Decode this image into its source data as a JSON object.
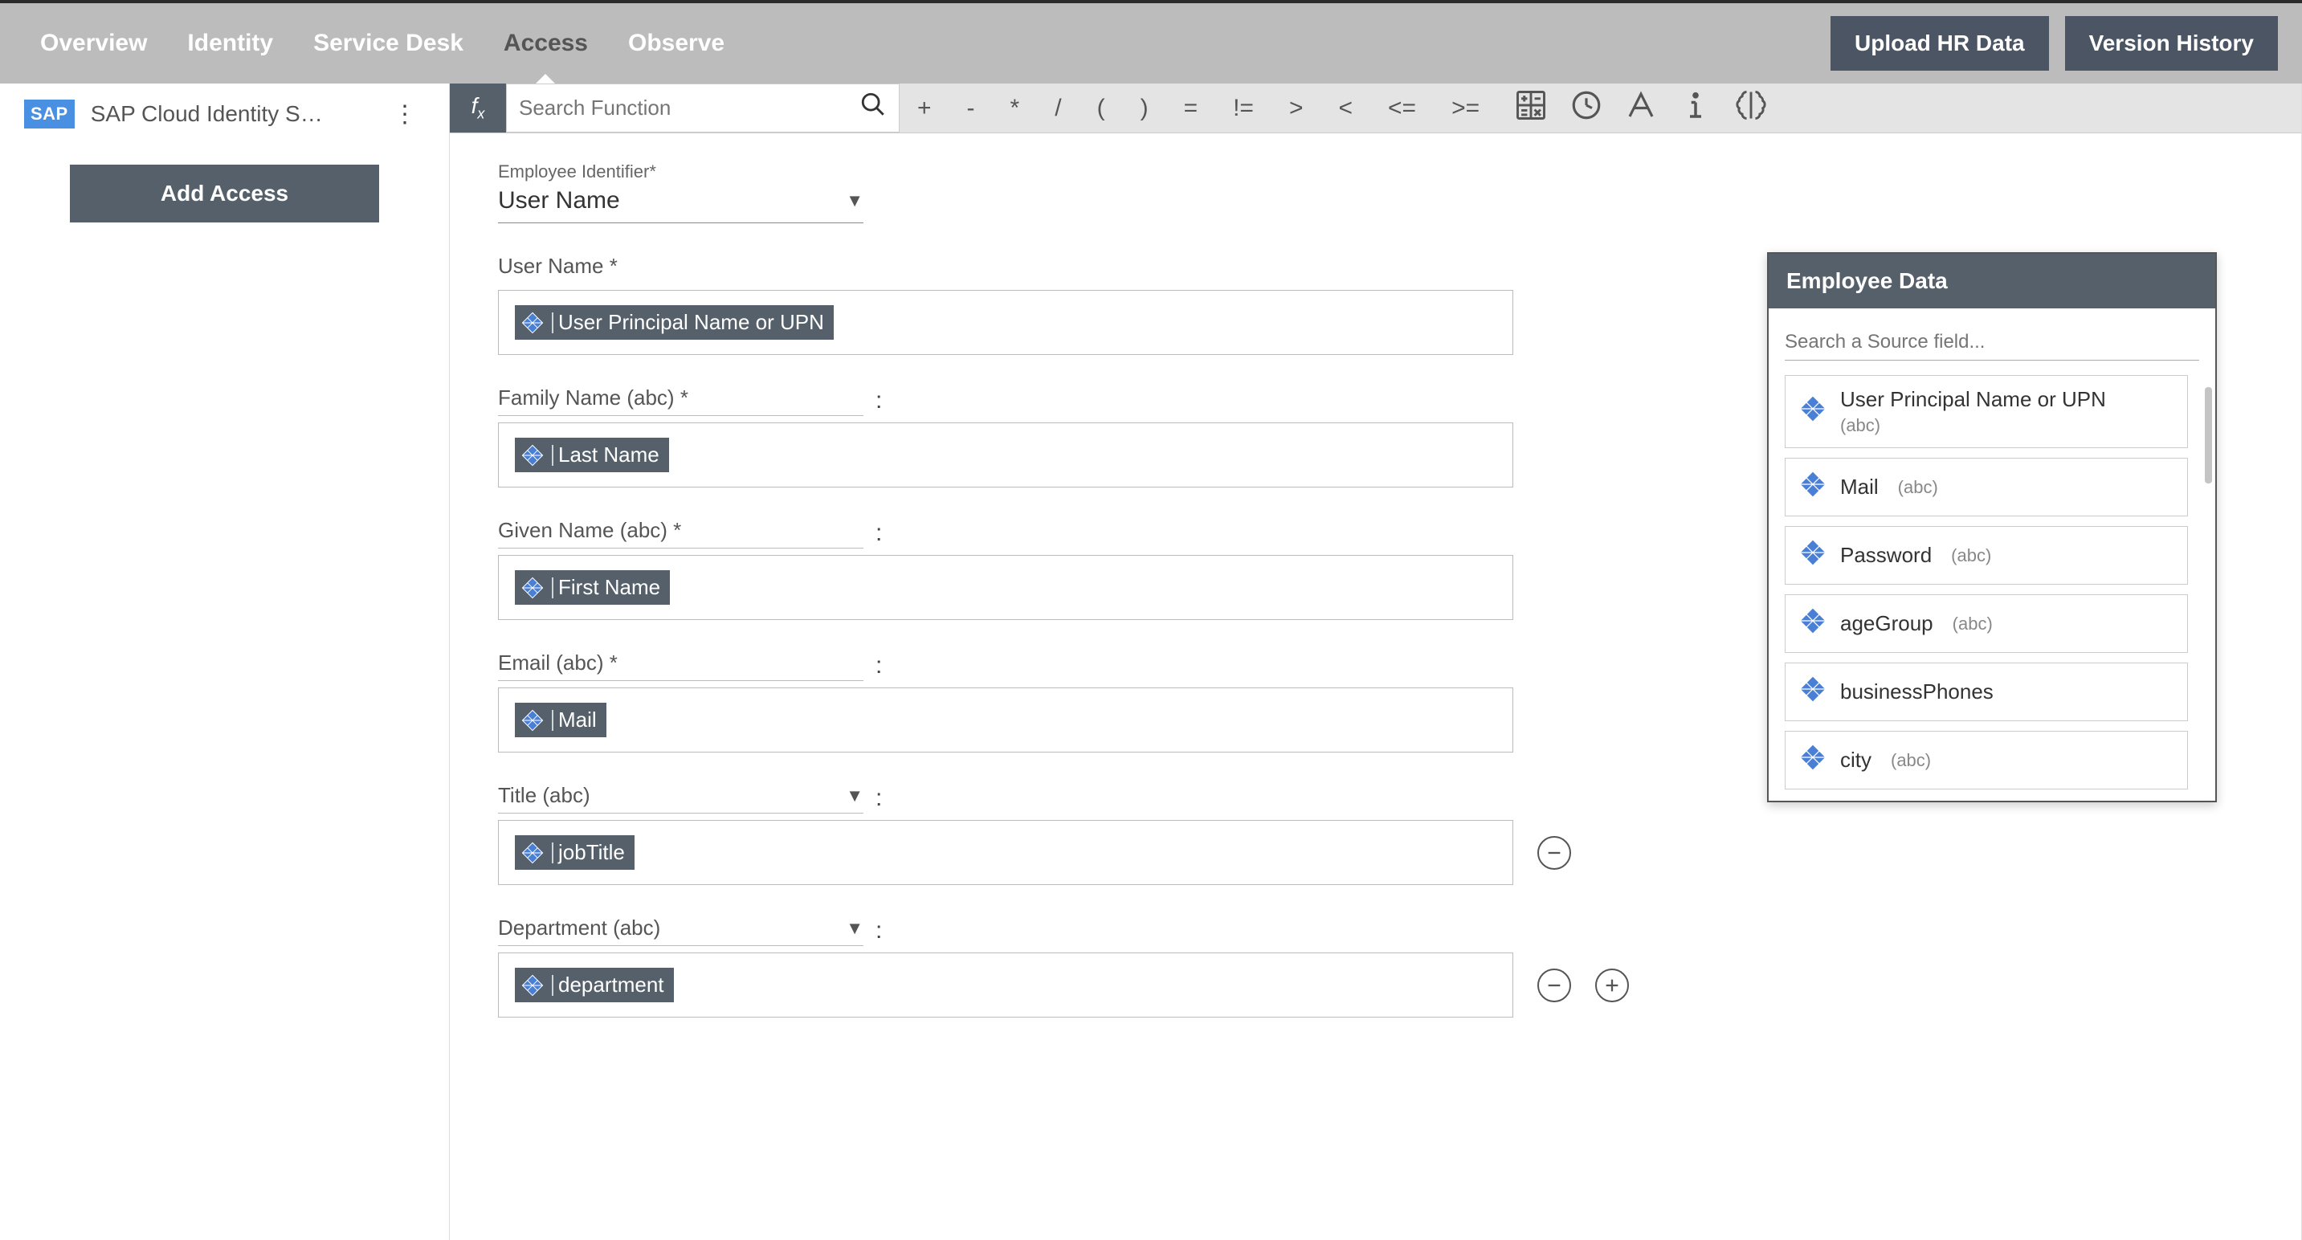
{
  "nav": {
    "tabs": [
      "Overview",
      "Identity",
      "Service Desk",
      "Access",
      "Observe"
    ],
    "active_index": 3,
    "upload_btn": "Upload HR Data",
    "history_btn": "Version History"
  },
  "sidebar": {
    "logo_text": "SAP",
    "item_label": "SAP Cloud Identity S…",
    "add_access_btn": "Add Access"
  },
  "formula_bar": {
    "fx_label": "fx",
    "search_placeholder": "Search Function",
    "operators": [
      "+",
      "-",
      "*",
      "/",
      "(",
      ")",
      "=",
      "!=",
      ">",
      "<",
      "<=",
      ">="
    ],
    "tool_icons": [
      "calculator-icon",
      "clock-icon",
      "font-icon",
      "info-icon",
      "brain-icon"
    ]
  },
  "form": {
    "emp_id_label": "Employee Identifier*",
    "emp_id_value": "User Name",
    "fields": [
      {
        "label": "User Name *",
        "has_colon": false,
        "dropdown": false,
        "chip": "User Principal Name or UPN",
        "remove": false,
        "add": false
      },
      {
        "label": "Family Name (abc) *",
        "has_colon": true,
        "dropdown": false,
        "chip": "Last Name",
        "remove": false,
        "add": false
      },
      {
        "label": "Given Name (abc) *",
        "has_colon": true,
        "dropdown": false,
        "chip": "First Name",
        "remove": false,
        "add": false
      },
      {
        "label": "Email (abc) *",
        "has_colon": true,
        "dropdown": false,
        "chip": "Mail",
        "remove": false,
        "add": false
      },
      {
        "label": "Title (abc)",
        "has_colon": true,
        "dropdown": true,
        "chip": "jobTitle",
        "remove": true,
        "add": false
      },
      {
        "label": "Department (abc)",
        "has_colon": true,
        "dropdown": true,
        "chip": "department",
        "remove": true,
        "add": true
      }
    ]
  },
  "popup": {
    "title": "Employee Data",
    "search_placeholder": "Search a Source field...",
    "items": [
      {
        "name": "User Principal Name or UPN",
        "type": "(abc)",
        "two_line": true
      },
      {
        "name": "Mail",
        "type": "(abc)",
        "two_line": false
      },
      {
        "name": "Password",
        "type": "(abc)",
        "two_line": false
      },
      {
        "name": "ageGroup",
        "type": "(abc)",
        "two_line": false
      },
      {
        "name": "businessPhones",
        "type": "",
        "two_line": false
      },
      {
        "name": "city",
        "type": "(abc)",
        "two_line": false
      }
    ]
  }
}
